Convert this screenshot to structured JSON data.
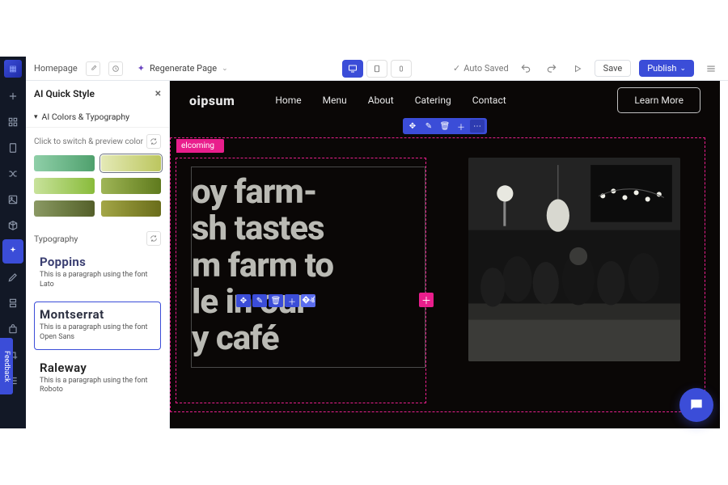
{
  "topbar": {
    "breadcrumb": "Homepage",
    "regenerate": "Regenerate Page",
    "auto_saved": "Auto Saved",
    "save": "Save",
    "publish": "Publish"
  },
  "rail": {
    "feedback": "Feedback"
  },
  "panel": {
    "title": "AI Quick Style",
    "section_colors_typo": "AI Colors & Typography",
    "color_hint": "Click to switch & preview color",
    "typography_label": "Typography",
    "fonts": [
      {
        "name": "Poppins",
        "desc": "This is a paragraph using the font Lato"
      },
      {
        "name": "Montserrat",
        "desc": "This is a paragraph using the font Open Sans"
      },
      {
        "name": "Raleway",
        "desc": "This is a paragraph using the font Roboto"
      }
    ]
  },
  "site": {
    "logo": "oipsum",
    "nav": [
      "Home",
      "Menu",
      "About",
      "Catering",
      "Contact"
    ],
    "cta": "Learn More",
    "badge": "elcoming",
    "headline": "oy farm-\nsh tastes\nm farm to\nle in our\ny café"
  }
}
